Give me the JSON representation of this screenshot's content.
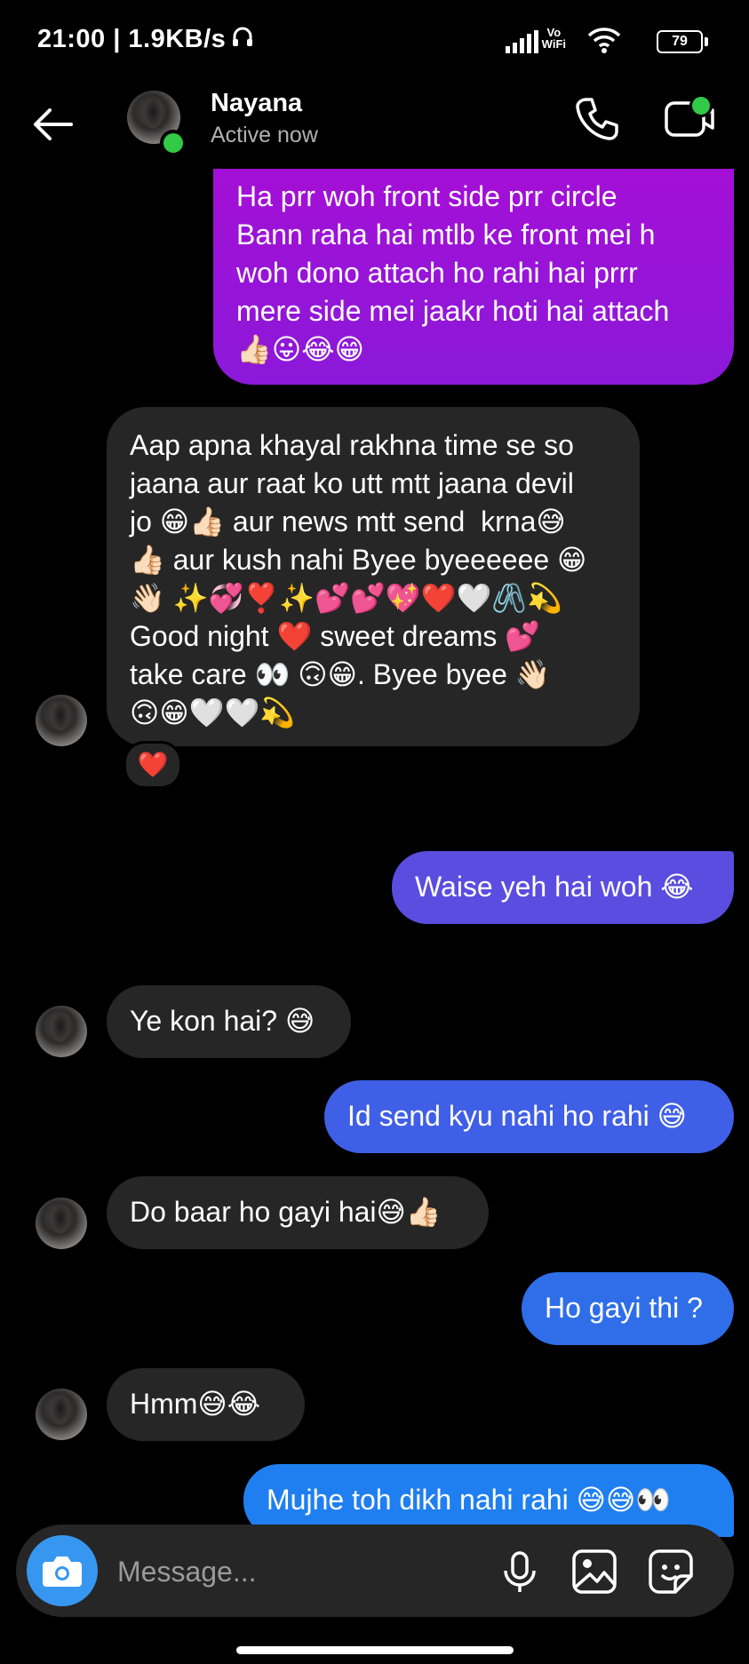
{
  "status_bar": {
    "time": "21:00 | 1.9KB/s",
    "vowifi_top": "Vo",
    "vowifi_bottom": "WiFi",
    "battery": "79"
  },
  "header": {
    "contact_name": "Nayana",
    "contact_status": "Active now"
  },
  "messages": [
    {
      "from": "me",
      "text": "Ha prr woh front side prr circle\nBann raha hai mtlb ke front mei h\nwoh dono attach ho rahi hai prrr\nmere side mei jaakr hoti hai attach\n👍🏻😛😂😁"
    },
    {
      "from": "them",
      "text": "Aap apna khayal rakhna time se so\njaana aur raat ko utt mtt jaana devil\njo 😁👍🏻 aur news mtt send  krna😅\n👍🏻 aur kush nahi Byee byeeeeee 😁\n👋🏻 ✨💞❣️✨💕💕💖❤️🤍🖇️💫\nGood night ❤️ sweet dreams 💕\ntake care 👀 🙃😁. Byee byee 👋🏻\n🙃😁🤍🤍💫",
      "reaction": "❤️"
    },
    {
      "from": "me",
      "text": "Waise yeh hai woh 😂"
    },
    {
      "from": "them",
      "text": "Ye kon hai? 😅"
    },
    {
      "from": "me",
      "text": "Id send kyu nahi ho rahi 😅"
    },
    {
      "from": "them",
      "text": "Do baar ho gayi hai😅👍🏻"
    },
    {
      "from": "me",
      "text": "Ho gayi thi ?"
    },
    {
      "from": "them",
      "text": "Hmm😅😂"
    },
    {
      "from": "me",
      "text": "Mujhe toh dikh nahi rahi 😅😅👀"
    }
  ],
  "composer": {
    "placeholder": "Message..."
  },
  "colors": {
    "accent_blue": "#3797f0",
    "online_green": "#31c946",
    "incoming_bubble": "#262626"
  }
}
